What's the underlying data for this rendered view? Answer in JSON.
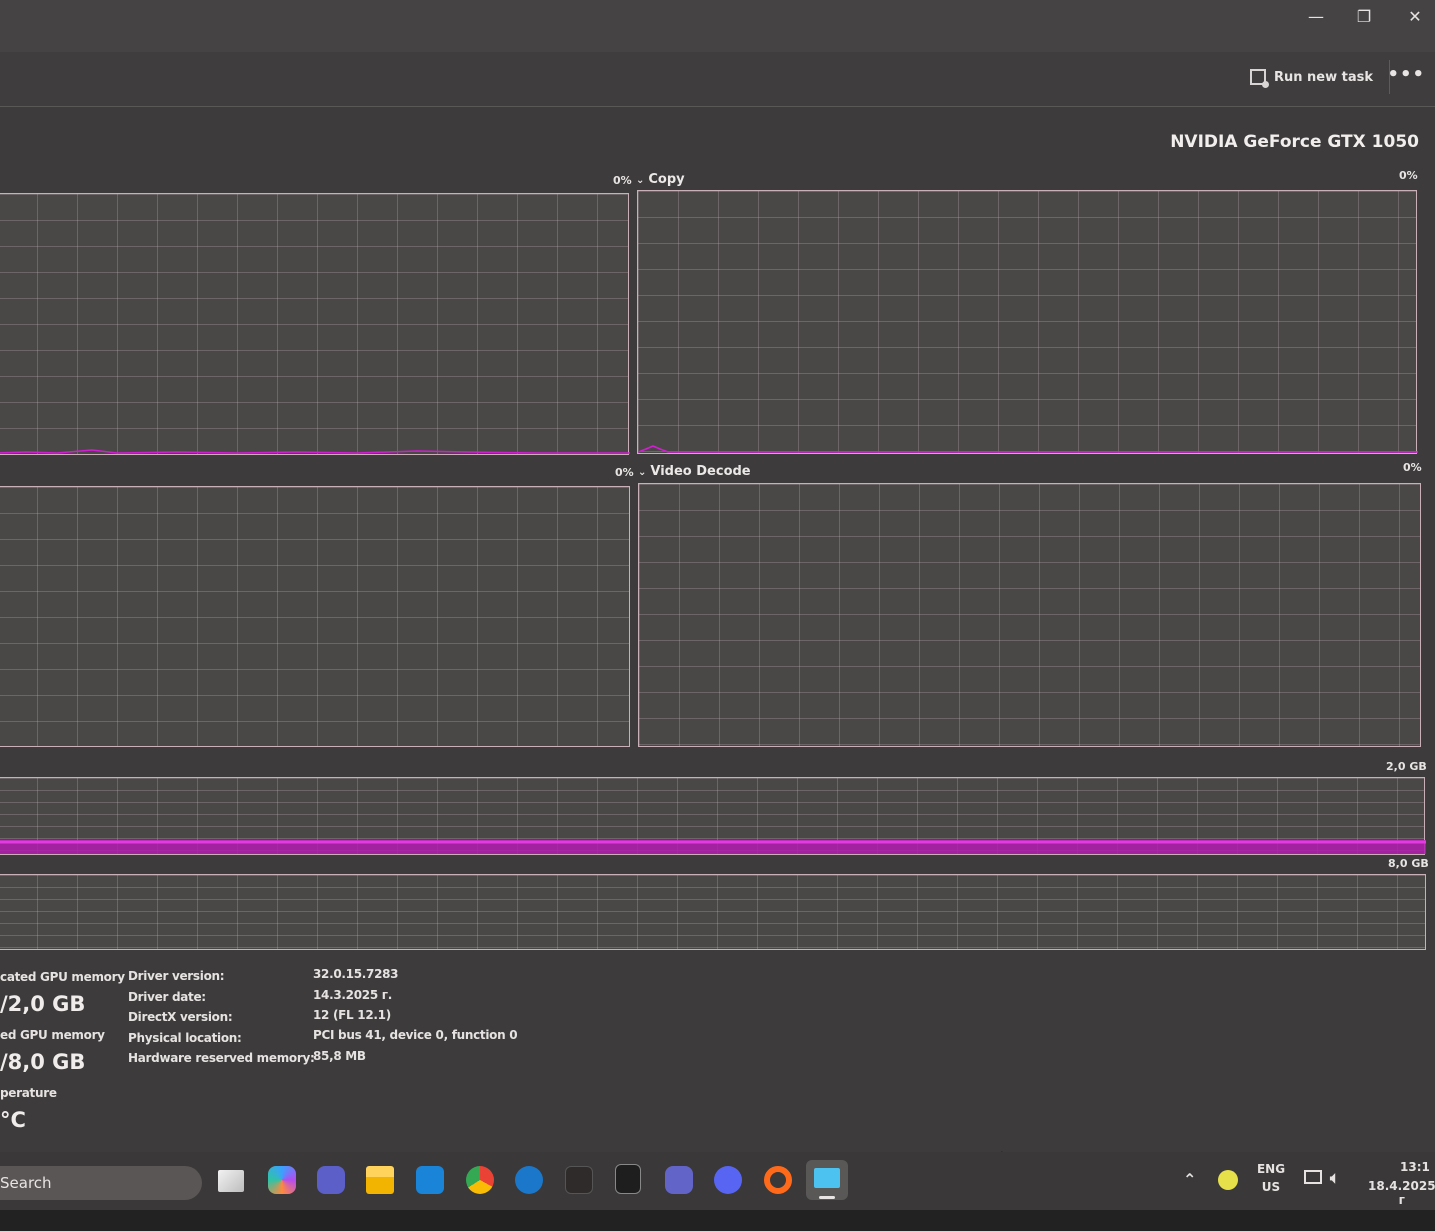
{
  "window": {
    "minimize_glyph": "—",
    "restore_glyph": "❐",
    "close_glyph": "✕"
  },
  "commandbar": {
    "run_new_task": "Run new task",
    "more_glyph": "•••"
  },
  "gpu": {
    "name": "NVIDIA GeForce GTX 1050"
  },
  "graphs": {
    "top_left_pct": "0%",
    "copy": {
      "label": "Copy",
      "pct": "0%"
    },
    "mid_left_pct": "0%",
    "video_decode": {
      "label": "Video Decode",
      "pct": "0%"
    },
    "dedicated_max": "2,0 GB",
    "shared_max": "8,0 GB"
  },
  "stats": {
    "dedicated_label": "cated GPU memory",
    "dedicated_value": "/2,0 GB",
    "shared_label": "ed GPU memory",
    "shared_value": "/8,0 GB",
    "temp_label": "perature",
    "temp_value": "°C"
  },
  "details": [
    {
      "key": "Driver version:",
      "value": "32.0.15.7283"
    },
    {
      "key": "Driver date:",
      "value": "14.3.2025 г."
    },
    {
      "key": "DirectX version:",
      "value": "12 (FL 12.1)"
    },
    {
      "key": "Physical location:",
      "value": "PCI bus 41, device 0, function 0"
    },
    {
      "key": "Hardware reserved memory:",
      "value": "85,8 MB"
    }
  ],
  "taskbar": {
    "search": "Search",
    "apps": [
      "task-view",
      "copilot",
      "teams",
      "file-explorer",
      "outlook",
      "chrome",
      "steam",
      "sublime",
      "epic-games",
      "teams-work",
      "discord",
      "opera",
      "task-manager"
    ],
    "lang_top": "ENG",
    "lang_bottom": "US",
    "time": "13:1",
    "date": "18.4.2025 г"
  },
  "colors": {
    "accent_magenta": "#d21ed2",
    "grid_line": "#c9b0b8"
  }
}
